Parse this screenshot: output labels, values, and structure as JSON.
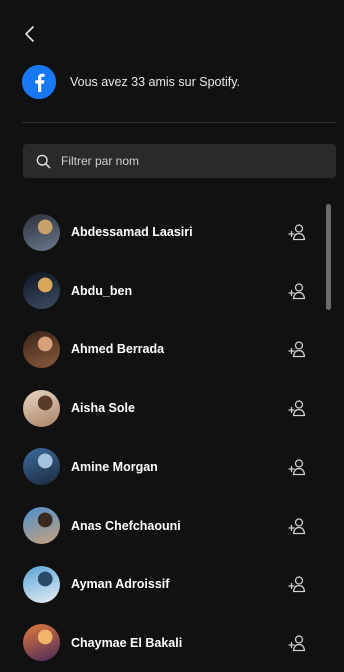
{
  "header": {
    "back_icon": "chevron-left-icon"
  },
  "facebook": {
    "icon": "facebook-icon",
    "message": "Vous avez 33 amis sur Spotify.",
    "brand_color": "#1877f2"
  },
  "search": {
    "placeholder": "Filtrer par nom",
    "value": "",
    "icon": "search-icon"
  },
  "friends": [
    {
      "name": "Abdessamad Laasiri",
      "avatar_colors": [
        "#2b2f37",
        "#6b7a8e",
        "#c7a06a"
      ]
    },
    {
      "name": "Abdu_ben",
      "avatar_colors": [
        "#0d1420",
        "#3f4e66",
        "#d9a75a"
      ]
    },
    {
      "name": "Ahmed Berrada",
      "avatar_colors": [
        "#3a2418",
        "#8b5a3c",
        "#d6a07a"
      ]
    },
    {
      "name": "Aisha Sole",
      "avatar_colors": [
        "#e9d6c3",
        "#a88367",
        "#5a3b2a"
      ]
    },
    {
      "name": "Amine Morgan",
      "avatar_colors": [
        "#3d6c9e",
        "#1c2a3c",
        "#a7c2de"
      ]
    },
    {
      "name": "Anas Chefchaouni",
      "avatar_colors": [
        "#4d8fcf",
        "#c8a27a",
        "#3a2a20"
      ]
    },
    {
      "name": "Ayman Adroissif",
      "avatar_colors": [
        "#5aa3d6",
        "#e7eef5",
        "#2a4a6a"
      ]
    },
    {
      "name": "Chaymae El Bakali",
      "avatar_colors": [
        "#e37a3c",
        "#4a2a5a",
        "#f0b46a"
      ]
    }
  ],
  "follow_icon": "add-friend-icon"
}
